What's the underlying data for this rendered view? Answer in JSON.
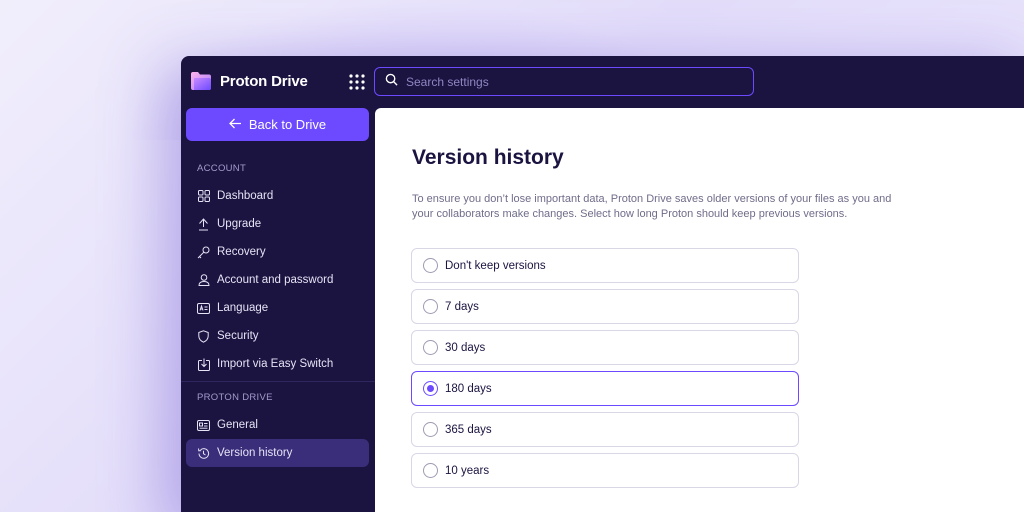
{
  "app": {
    "name": "Proton Drive"
  },
  "search": {
    "placeholder": "Search settings"
  },
  "sidebar": {
    "back_label": "Back to Drive",
    "account_section": "ACCOUNT",
    "account_items": [
      {
        "label": "Dashboard",
        "icon": "dashboard-icon"
      },
      {
        "label": "Upgrade",
        "icon": "upgrade-icon"
      },
      {
        "label": "Recovery",
        "icon": "key-icon"
      },
      {
        "label": "Account and password",
        "icon": "user-icon"
      },
      {
        "label": "Language",
        "icon": "language-icon"
      },
      {
        "label": "Security",
        "icon": "shield-icon"
      },
      {
        "label": "Import via Easy Switch",
        "icon": "import-icon"
      }
    ],
    "drive_section": "PROTON DRIVE",
    "drive_items": [
      {
        "label": "General",
        "icon": "id-card-icon"
      },
      {
        "label": "Version history",
        "icon": "history-icon",
        "active": true
      }
    ]
  },
  "main": {
    "title": "Version history",
    "description": "To ensure you don’t lose important data, Proton Drive saves older versions of your files as you and your collaborators make changes. Select how long Proton should keep previous versions.",
    "options": [
      {
        "label": "Don't keep versions",
        "selected": false
      },
      {
        "label": "7 days",
        "selected": false
      },
      {
        "label": "30 days",
        "selected": false
      },
      {
        "label": "180 days",
        "selected": true
      },
      {
        "label": "365 days",
        "selected": false
      },
      {
        "label": "10 years",
        "selected": false
      }
    ]
  },
  "colors": {
    "accent": "#6d4aff",
    "sidebar_bg": "#1b1340",
    "active_item": "#3a2d7a"
  }
}
